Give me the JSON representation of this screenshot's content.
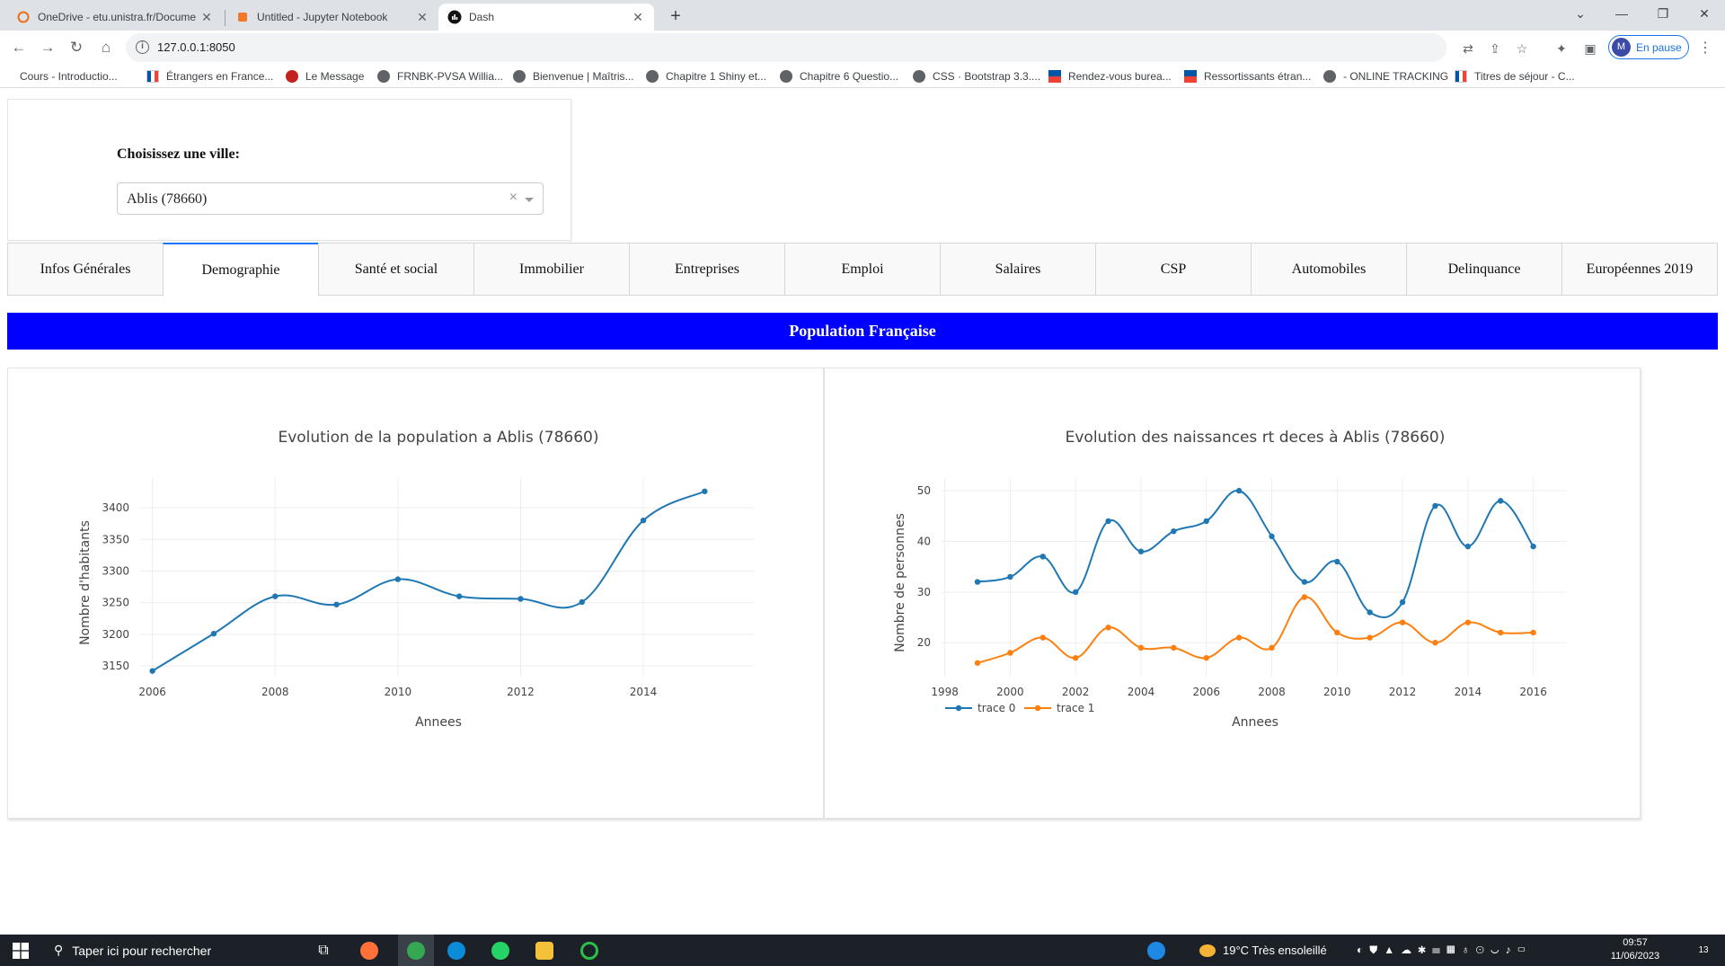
{
  "browser": {
    "tabs": [
      {
        "title": "OneDrive - etu.unistra.fr/Docume",
        "icon": "onedrive-icon"
      },
      {
        "title": "Untitled - Jupyter Notebook",
        "icon": "jupyter-icon"
      },
      {
        "title": "Dash",
        "icon": "dash-icon"
      }
    ],
    "url": "127.0.0.1:8050",
    "profile_label": "En pause",
    "profile_initial": "M",
    "bookmarks": [
      "Cours - Introductio...",
      "Étrangers en France...",
      "Le Message",
      "FRNBK-PVSA Willia...",
      "Bienvenue | Maîtris...",
      "Chapitre 1 Shiny et...",
      "Chapitre 6 Questio...",
      "CSS · Bootstrap 3.3....",
      "Rendez-vous burea...",
      "Ressortissants étran...",
      "- ONLINE TRACKING",
      "Titres de séjour - C..."
    ]
  },
  "dropdown": {
    "label": "Choisissez une ville:",
    "value": "Ablis (78660)",
    "clear": "×"
  },
  "tabs": [
    {
      "label": "Infos Générales"
    },
    {
      "label": "Demographie"
    },
    {
      "label": "Santé et social"
    },
    {
      "label": "Immobilier"
    },
    {
      "label": "Entreprises"
    },
    {
      "label": "Emploi"
    },
    {
      "label": "Salaires"
    },
    {
      "label": "CSP"
    },
    {
      "label": "Automobiles"
    },
    {
      "label": "Delinquance"
    },
    {
      "label": "Européennes 2019"
    }
  ],
  "selected_tab": "Demographie",
  "banner": "Population Française",
  "colors": {
    "banner": "#0000ff",
    "series0": "#1f77b4",
    "series1": "#ff7f0e",
    "tab_accent": "#1975fa"
  },
  "chart_data": [
    {
      "type": "line",
      "title": "Evolution de la population a Ablis (78660)",
      "xlabel": "Annees",
      "ylabel": "Nombre d'habitants",
      "x": [
        2006,
        2007,
        2008,
        2009,
        2010,
        2011,
        2012,
        2013,
        2014,
        2015
      ],
      "series": [
        {
          "values": [
            3142,
            3201,
            3260,
            3247,
            3287,
            3260,
            3256,
            3251,
            3380,
            3426
          ]
        }
      ],
      "xticks": [
        2006,
        2008,
        2010,
        2012,
        2014
      ],
      "yticks": [
        3150,
        3200,
        3250,
        3300,
        3350,
        3400
      ],
      "xlim": [
        2005.8,
        2015.8
      ],
      "ylim": [
        3133,
        3447
      ],
      "grid": true,
      "smooth": true
    },
    {
      "type": "line",
      "title": "Evolution des naissances rt deces à Ablis (78660)",
      "xlabel": "Annees",
      "ylabel": "Nombre de personnes",
      "x": [
        1999,
        2000,
        2001,
        2002,
        2003,
        2004,
        2005,
        2006,
        2007,
        2008,
        2009,
        2010,
        2011,
        2012,
        2013,
        2014,
        2015,
        2016
      ],
      "series": [
        {
          "name": "trace 0",
          "values": [
            32,
            33,
            37,
            30,
            44,
            38,
            42,
            44,
            50,
            41,
            32,
            36,
            26,
            28,
            47,
            39,
            48,
            39
          ]
        },
        {
          "name": "trace 1",
          "values": [
            16,
            18,
            21,
            17,
            23,
            19,
            19,
            17,
            21,
            19,
            29,
            22,
            21,
            24,
            20,
            24,
            22,
            22
          ]
        }
      ],
      "xticks": [
        1998,
        2000,
        2002,
        2004,
        2006,
        2008,
        2010,
        2012,
        2014,
        2016
      ],
      "yticks": [
        20,
        30,
        40,
        50
      ],
      "xlim": [
        1997.9,
        2017.0
      ],
      "ylim": [
        13.3,
        52.5
      ],
      "grid": true,
      "smooth": true,
      "legend": "bottom-left"
    }
  ],
  "taskbar": {
    "search_placeholder": "Taper ici pour rechercher",
    "weather": "19°C  Très ensoleillé",
    "time": "09:57",
    "date": "11/06/2023",
    "notif_count": "13"
  }
}
